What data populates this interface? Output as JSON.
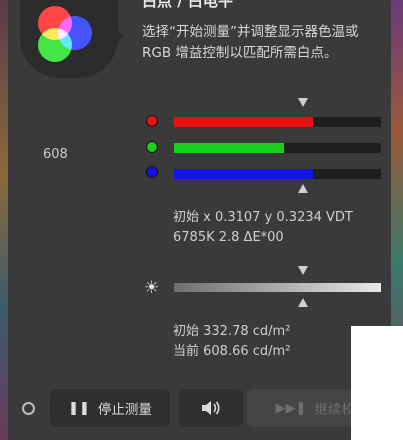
{
  "title": "白点 / 白电平",
  "instruction": "选择“开始测量”并调整显示器色温或RGB 增益控制以匹配所需白点。",
  "side_value": "608",
  "rgb_channels": [
    {
      "name": "red",
      "color": "#e41414",
      "level": 0.67
    },
    {
      "name": "green",
      "color": "#18d018",
      "level": 0.53
    },
    {
      "name": "blue",
      "color": "#1414e0",
      "level": 0.67
    }
  ],
  "chromaticity": {
    "line1": "初始 x 0.3107 y 0.3234 VDT",
    "line2": "6785K 2.8 ΔE*00"
  },
  "luminance": {
    "initial": "初始 332.78 cd/m²",
    "current": "当前 608.66 cd/m²"
  },
  "buttons": {
    "stop_label": "停止测量",
    "continue_label": "继续校准"
  },
  "icons": {
    "pause": "pause-icon",
    "speaker": "speaker-icon",
    "skip": "skip-forward-icon",
    "sun": "brightness-icon"
  }
}
